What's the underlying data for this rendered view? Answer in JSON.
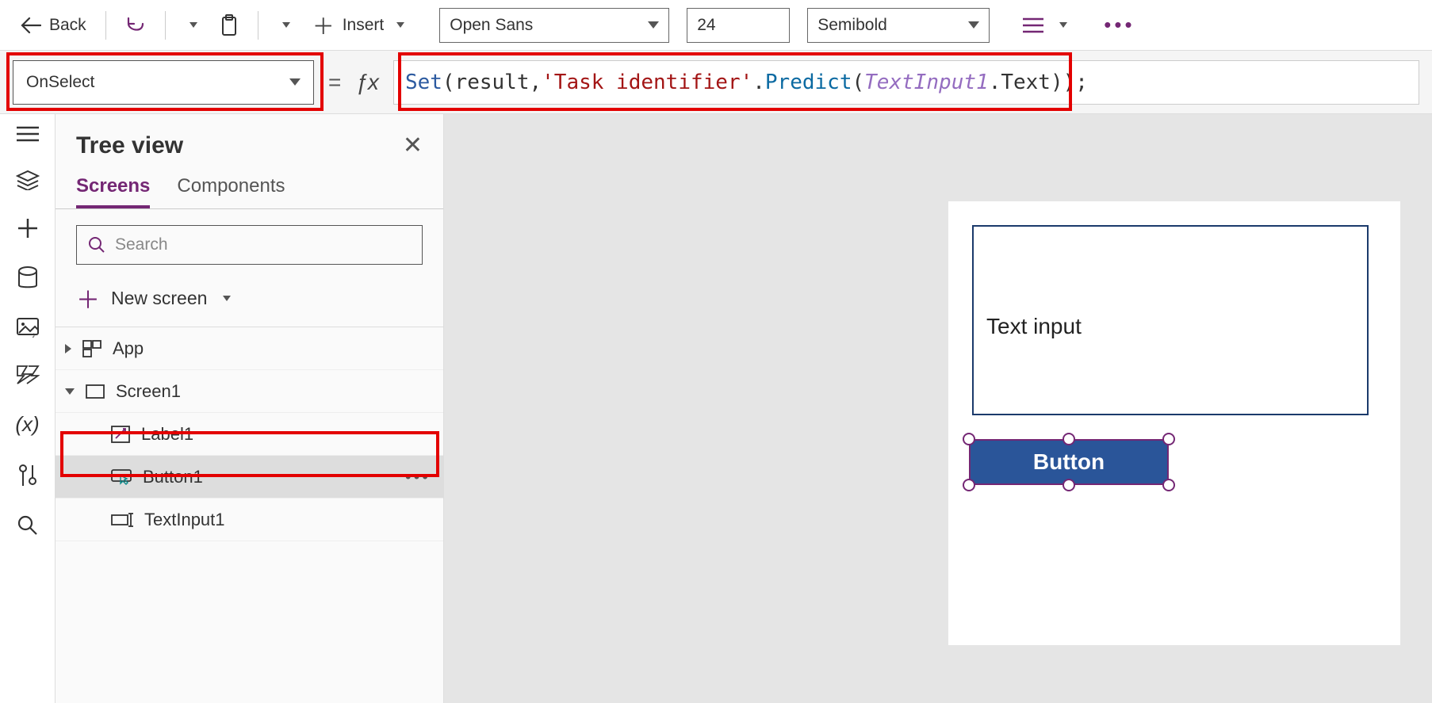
{
  "toolbar": {
    "back_label": "Back",
    "insert_label": "Insert",
    "font_family": "Open Sans",
    "font_size": "24",
    "font_weight": "Semibold"
  },
  "formula": {
    "property": "OnSelect",
    "tokens": {
      "set": "Set",
      "open": "(result, ",
      "str": "'Task identifier'",
      "dot1": ".",
      "predict": "Predict",
      "open2": "(",
      "id": "TextInput1",
      "dot2": ".Text));"
    }
  },
  "tree": {
    "title": "Tree view",
    "tabs": {
      "screens": "Screens",
      "components": "Components"
    },
    "search_placeholder": "Search",
    "new_screen": "New screen",
    "items": {
      "app": "App",
      "screen1": "Screen1",
      "label1": "Label1",
      "button1": "Button1",
      "textinput1": "TextInput1"
    }
  },
  "canvas": {
    "text_input_value": "Text input",
    "button_label": "Button"
  }
}
